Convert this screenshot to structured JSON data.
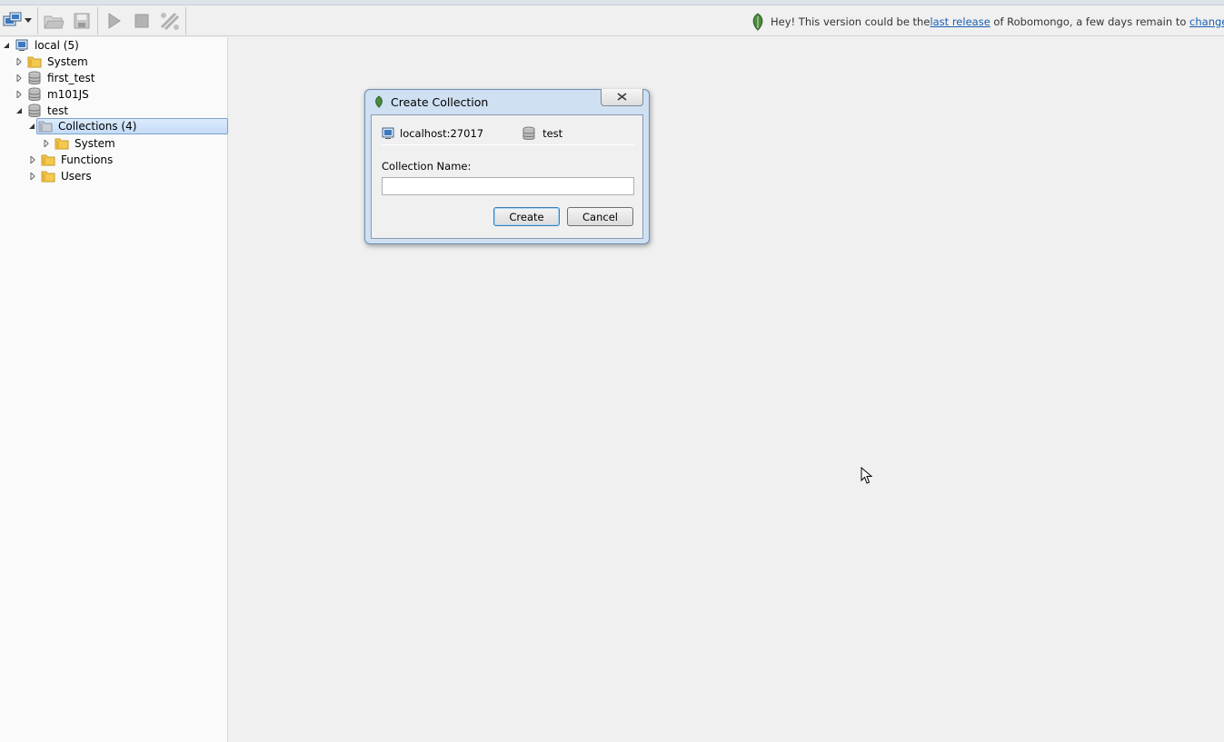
{
  "notice": {
    "prefix": "Hey! This version could be the ",
    "link1": "last release",
    "middle": " of Robomongo, a few days remain to ",
    "link2": "change it",
    "suffix": "."
  },
  "toolbar": {
    "icons": [
      "connect-icon",
      "dropdown-arrow-icon",
      "open-icon",
      "save-icon",
      "execute-icon",
      "stop-icon",
      "orientation-icon"
    ]
  },
  "tree": {
    "root": "local (5)",
    "items": [
      {
        "label": "System",
        "type": "folder"
      },
      {
        "label": "first_test",
        "type": "database"
      },
      {
        "label": "m101JS",
        "type": "database"
      },
      {
        "label": "test",
        "type": "database"
      }
    ],
    "test_children": [
      {
        "label": "Collections (4)"
      },
      {
        "label": "System"
      },
      {
        "label": "Functions"
      },
      {
        "label": "Users"
      }
    ]
  },
  "dialog": {
    "title": "Create Collection",
    "server": "localhost:27017",
    "database": "test",
    "field_label": "Collection Name:",
    "input_value": "",
    "create_label": "Create",
    "cancel_label": "Cancel"
  }
}
